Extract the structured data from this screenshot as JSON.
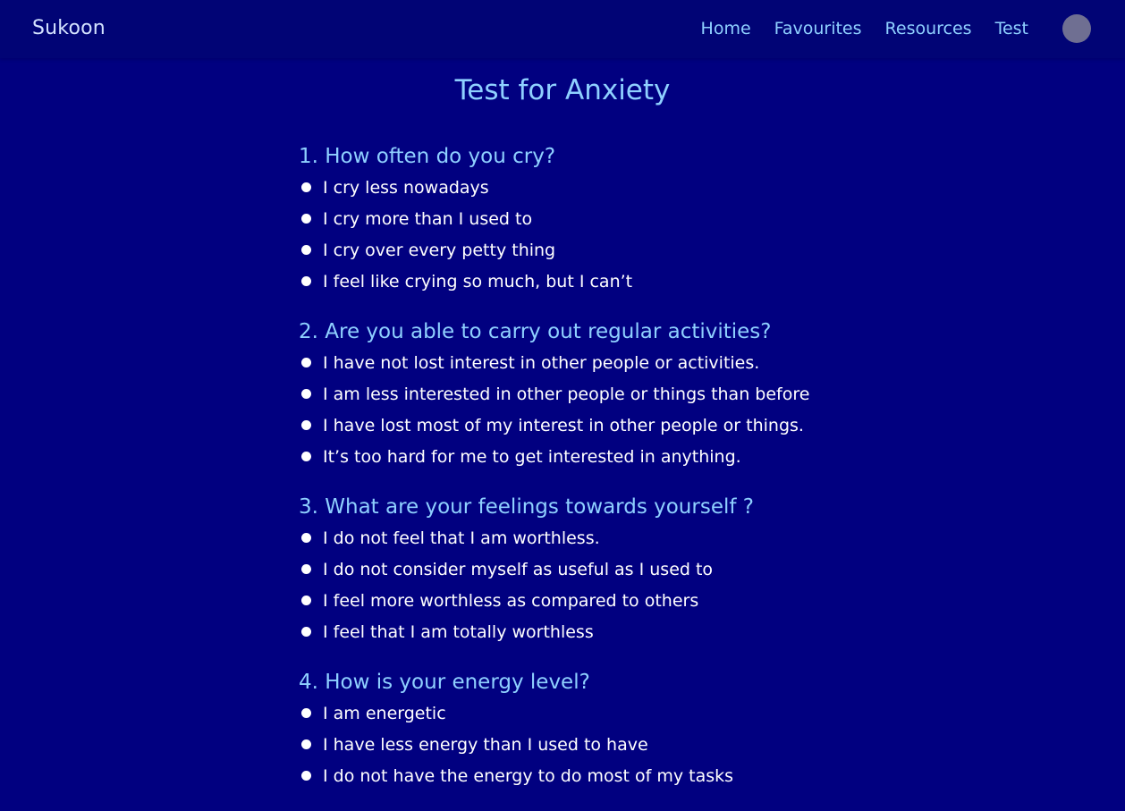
{
  "navbar": {
    "brand": "Sukoon",
    "links": [
      "Home",
      "Favourites",
      "Resources",
      "Test"
    ]
  },
  "page_title": "Test for Anxiety",
  "questions": [
    {
      "title": "1. How often do you cry?",
      "options": [
        "I cry less nowadays",
        "I cry more than I used to",
        "I cry over every petty thing",
        "I feel like crying so much, but I can’t"
      ]
    },
    {
      "title": "2. Are you able to carry out regular activities?",
      "options": [
        "I have not lost interest in other people or activities.",
        "I am less interested in other people or things than before",
        "I have lost most of my interest in other people or things.",
        "It’s too hard for me to get interested in anything."
      ]
    },
    {
      "title": "3. What are your feelings towards yourself ?",
      "options": [
        "I do not feel that I am worthless.",
        "I do not consider myself as useful as I used to",
        "I feel more worthless as compared to others",
        "I feel that I am totally worthless"
      ]
    },
    {
      "title": "4. How is your energy level?",
      "options": [
        "I am energetic",
        "I have less energy than I used to have",
        "I do not have the energy to do most of my tasks"
      ]
    }
  ]
}
